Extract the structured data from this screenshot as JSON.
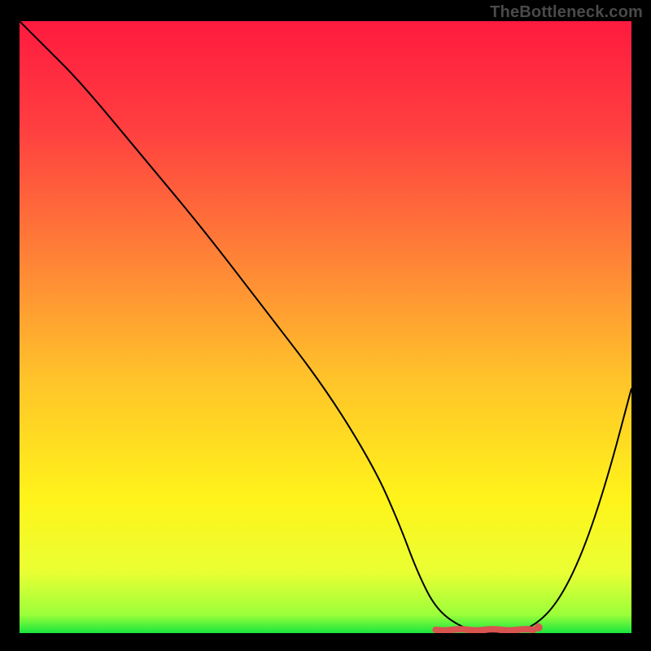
{
  "watermark": "TheBottleneck.com",
  "chart_data": {
    "type": "line",
    "title": "",
    "xlabel": "",
    "ylabel": "",
    "xlim": [
      0,
      100
    ],
    "ylim": [
      0,
      100
    ],
    "x": [
      0,
      4,
      10,
      20,
      30,
      40,
      50,
      58,
      62,
      65,
      68,
      72,
      76,
      80,
      84,
      88,
      92,
      96,
      100
    ],
    "values": [
      100,
      96,
      90,
      78,
      66,
      53,
      40,
      27,
      18,
      10,
      4,
      1,
      0,
      0,
      1,
      5,
      13,
      25,
      40
    ],
    "series": [
      {
        "name": "curve",
        "role": "primary-line",
        "color": "#000000"
      }
    ],
    "flat_region": {
      "x_start": 68,
      "x_end": 84,
      "y": 0,
      "marker_color": "#d9534f"
    },
    "background_gradient": {
      "direction": "vertical",
      "stops": [
        {
          "offset": 0.0,
          "color": "#ff1a3f"
        },
        {
          "offset": 0.18,
          "color": "#ff4040"
        },
        {
          "offset": 0.38,
          "color": "#ff8037"
        },
        {
          "offset": 0.58,
          "color": "#ffc22a"
        },
        {
          "offset": 0.78,
          "color": "#fff31a"
        },
        {
          "offset": 0.9,
          "color": "#eaff33"
        },
        {
          "offset": 0.97,
          "color": "#9bff3a"
        },
        {
          "offset": 1.0,
          "color": "#19e63e"
        }
      ]
    }
  }
}
